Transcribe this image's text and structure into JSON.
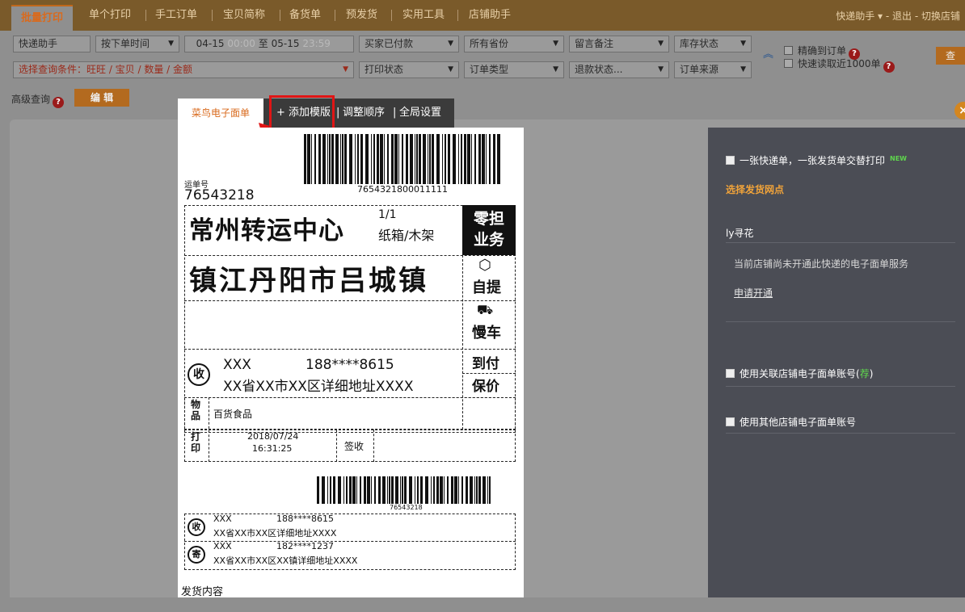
{
  "topnav": {
    "tabs": [
      "批量打印",
      "单个打印",
      "手工订单",
      "宝贝简称",
      "备货单",
      "预发货",
      "实用工具",
      "店铺助手"
    ],
    "right": "快递助手 ▾ - 退出 - 切换店铺"
  },
  "filters": {
    "shop": "快递助手",
    "time_type": "按下单时间",
    "date_from": "04-15",
    "time_from": "00:00",
    "date_sep": "至",
    "date_to": "05-15",
    "time_to": "23:59",
    "buyer_status": "买家已付款",
    "province": "所有省份",
    "remark": "留言备注",
    "stock": "库存状态",
    "query_cond": "选择查询条件：旺旺 / 宝贝 / 数量 / 金额",
    "print_status": "打印状态",
    "order_type": "订单类型",
    "refund": "退款状态...",
    "order_source": "订单来源",
    "exact_order": "精确到订单",
    "fast_1000": "快速读取近1000单",
    "query_button": "查"
  },
  "advanced": {
    "label": "高级查询",
    "edit": "编 辑"
  },
  "dialog": {
    "tab": "菜鸟电子面单",
    "toolbar": {
      "add": "+ 添加模版",
      "sep1": "|",
      "reorder": "调整顺序",
      "sep2": "|",
      "global": "全局设置"
    }
  },
  "waybill": {
    "no_label": "运单号",
    "no": "76543218",
    "barcode_text": "7654321800011111",
    "hub": "常州转运中心",
    "count": "1/1",
    "package": "纸箱/木架",
    "service1": "零担业务",
    "dest": "镇江丹阳市吕城镇",
    "pickup": "自提",
    "slow": "慢车",
    "cod": "到付",
    "insured": "保价",
    "recv_icon": "收",
    "recv_name": "XXX",
    "recv_phone": "188****8615",
    "recv_addr": "XX省XX市XX区详细地址XXXX",
    "goods_label": "物品",
    "goods": "百货食品",
    "print_label": "打印",
    "print_date": "2018/07/24",
    "print_time": "16:31:25",
    "sign": "签收",
    "barcode2_text": "76543218",
    "r2_name": "XXX",
    "r2_phone": "188****8615",
    "r2_addr": "XX省XX市XX区详细地址XXXX",
    "send_icon": "寄",
    "s_name": "XXX",
    "s_phone": "182****1237",
    "s_addr": "XX省XX市XX区XX镇详细地址XXXX",
    "content_label": "发货内容"
  },
  "sidepanel": {
    "alt_print": "一张快递单，一张发货单交替打印",
    "new": "NEW",
    "choose_outlet": "选择发货网点",
    "outlet": "ly寻花",
    "notice": "当前店铺尚未开通此快递的电子面单服务",
    "apply": "申请开通",
    "use_linked": "使用关联店铺电子面单账号(",
    "recommend": "荐",
    "use_linked_end": ")",
    "use_other": "使用其他店铺电子面单账号"
  },
  "colors": {
    "accent": "#d96a1d",
    "panel": "#4b4d55",
    "highlight": "#e01515"
  }
}
